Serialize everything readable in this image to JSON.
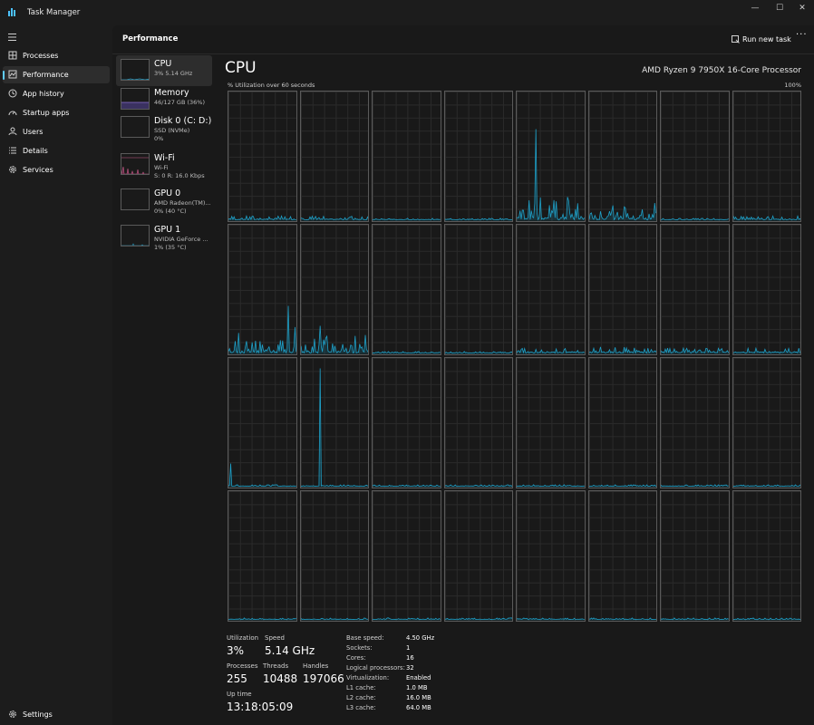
{
  "window": {
    "title": "Task Manager",
    "controls": {
      "minimize": "—",
      "maximize": "☐",
      "close": "✕"
    }
  },
  "nav": {
    "items": [
      {
        "label": "Processes",
        "icon": "processes-grid-icon",
        "active": false
      },
      {
        "label": "Performance",
        "icon": "performance-chart-icon",
        "active": true
      },
      {
        "label": "App history",
        "icon": "history-clock-icon",
        "active": false
      },
      {
        "label": "Startup apps",
        "icon": "startup-gauge-icon",
        "active": false
      },
      {
        "label": "Users",
        "icon": "users-icon",
        "active": false
      },
      {
        "label": "Details",
        "icon": "details-list-icon",
        "active": false
      },
      {
        "label": "Services",
        "icon": "services-gear-icon",
        "active": false
      }
    ],
    "settings_label": "Settings"
  },
  "header": {
    "title": "Performance",
    "run_task_label": "Run new task",
    "more_label": "···"
  },
  "devices": [
    {
      "name": "CPU",
      "line1": "3% 5.14 GHz",
      "line2": "",
      "active": true,
      "color": "#2aa0c8"
    },
    {
      "name": "Memory",
      "line1": "46/127 GB (36%)",
      "line2": "",
      "active": false,
      "color": "#8a6fd0"
    },
    {
      "name": "Disk 0 (C: D:)",
      "line1": "SSD (NVMe)",
      "line2": "0%",
      "active": false,
      "color": "#5fb85f"
    },
    {
      "name": "Wi-Fi",
      "line1": "Wi-Fi",
      "line2": "S: 0 R: 16.0 Kbps",
      "active": false,
      "color": "#c85a8a"
    },
    {
      "name": "GPU 0",
      "line1": "AMD Radeon(TM)...",
      "line2": "0% (40 °C)",
      "active": false,
      "color": "#2aa0c8"
    },
    {
      "name": "GPU 1",
      "line1": "NVIDIA GeForce ...",
      "line2": "1% (35 °C)",
      "active": false,
      "color": "#2aa0c8"
    }
  ],
  "cpu": {
    "title": "CPU",
    "model": "AMD Ryzen 9 7950X 16-Core Processor",
    "graph_label": "% Utilization over 60 seconds",
    "graph_max": "100%",
    "line_color": "#1ea0c8",
    "core_count": 32
  },
  "stats": {
    "utilization": {
      "label": "Utilization",
      "value": "3%"
    },
    "speed": {
      "label": "Speed",
      "value": "5.14 GHz"
    },
    "processes": {
      "label": "Processes",
      "value": "255"
    },
    "threads": {
      "label": "Threads",
      "value": "10488"
    },
    "handles": {
      "label": "Handles",
      "value": "197066"
    },
    "uptime": {
      "label": "Up time",
      "value": "13:18:05:09"
    }
  },
  "details": [
    {
      "label": "Base speed:",
      "value": "4.50 GHz"
    },
    {
      "label": "Sockets:",
      "value": "1"
    },
    {
      "label": "Cores:",
      "value": "16"
    },
    {
      "label": "Logical processors:",
      "value": "32"
    },
    {
      "label": "Virtualization:",
      "value": "Enabled"
    },
    {
      "label": "L1 cache:",
      "value": "1.0 MB"
    },
    {
      "label": "L2 cache:",
      "value": "16.0 MB"
    },
    {
      "label": "L3 cache:",
      "value": "64.0 MB"
    }
  ]
}
